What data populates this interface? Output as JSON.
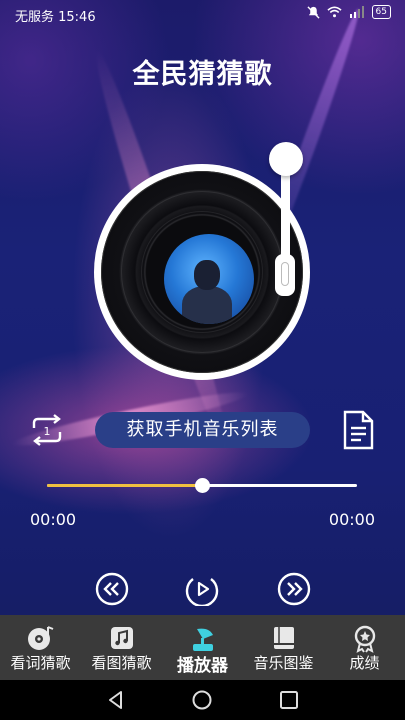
{
  "status_bar": {
    "time": "无服务 15:46",
    "battery": "65"
  },
  "app": {
    "title": "全民猜猜歌"
  },
  "player": {
    "fetch_button_label": "获取手机音乐列表",
    "loop_mode_badge": "1",
    "current_time": "00:00",
    "total_time": "00:00",
    "progress_fraction": 0.5
  },
  "tabs": [
    {
      "label": "看词猜歌",
      "icon": "vinyl-note-icon",
      "active": false
    },
    {
      "label": "看图猜歌",
      "icon": "music-image-icon",
      "active": false
    },
    {
      "label": "播放器",
      "icon": "gramophone-icon",
      "active": true
    },
    {
      "label": "音乐图鉴",
      "icon": "book-icon",
      "active": false
    },
    {
      "label": "成绩",
      "icon": "medal-icon",
      "active": false
    }
  ],
  "colors": {
    "accent": "#3fd0e0",
    "progress": "#f0c040",
    "tab_bar": "#3a3a3a"
  }
}
